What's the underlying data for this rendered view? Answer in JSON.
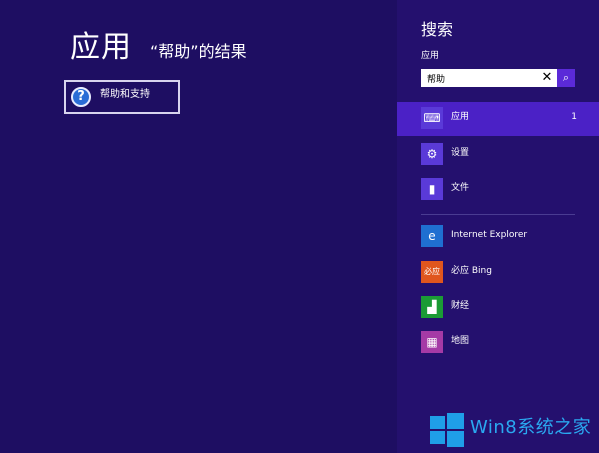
{
  "results": {
    "title": "应用",
    "subtitle": "“帮助”的结果",
    "items": [
      {
        "label": "帮助和支持",
        "icon": "help-icon",
        "glyph": "?"
      }
    ]
  },
  "search_pane": {
    "title": "搜索",
    "scope": "应用",
    "query": "帮助",
    "clear_glyph": "✕",
    "search_glyph": "⌕",
    "filters": [
      {
        "label": "应用",
        "count": "1",
        "icon": "keyboard-icon",
        "glyph": "⌨",
        "selected": true
      },
      {
        "label": "设置",
        "count": "",
        "icon": "gear-icon",
        "glyph": "⚙",
        "selected": false
      },
      {
        "label": "文件",
        "count": "",
        "icon": "document-icon",
        "glyph": "▮",
        "selected": false
      }
    ],
    "apps": [
      {
        "label": "Internet Explorer",
        "icon": "ie-icon",
        "glyph": "e"
      },
      {
        "label": "必应 Bing",
        "icon": "bing-icon",
        "glyph": "必应"
      },
      {
        "label": "财经",
        "icon": "finance-icon",
        "glyph": "▟"
      },
      {
        "label": "地图",
        "icon": "map-icon",
        "glyph": "▦"
      }
    ]
  },
  "watermark": {
    "text": "Win8系统之家"
  },
  "colors": {
    "background": "#1e0e62",
    "pane": "#24106e",
    "selected": "#4b21c6",
    "accent": "#5b2ad8"
  }
}
